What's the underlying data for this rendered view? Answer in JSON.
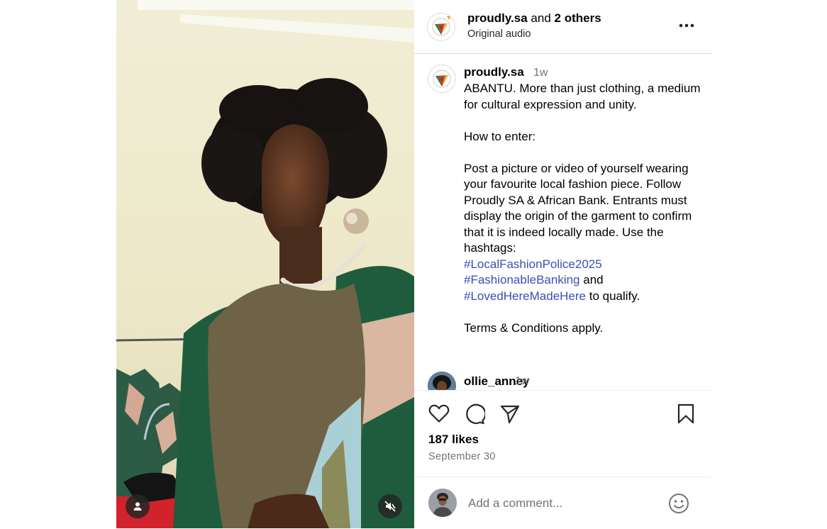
{
  "post": {
    "author": "proudly.sa",
    "coauthor_text": " and ",
    "others": "2 others",
    "audio": "Original audio"
  },
  "caption": {
    "username": "proudly.sa",
    "time": "1w",
    "text_before": "ABANTU. More than just clothing, a medium for cultural expression and unity.\n\nHow to enter:\n\nPost a picture or video of yourself wearing your favourite local fashion piece. Follow Proudly SA & African Bank. Entrants must display the origin of the garment to confirm that it is indeed locally made. Use the hashtags:\n",
    "hashtag1": "#LocalFashionPolice2025",
    "hashtag2": "#FashionableBanking",
    "and_text": " and",
    "hashtag3": "#LovedHereMadeHere",
    "text_after": " to qualify.\n\nTerms & Conditions apply."
  },
  "comment": {
    "username": "ollie_anney",
    "time": "1w"
  },
  "actions": {
    "like_icon": "heart-icon",
    "comment_icon": "comment-bubble-icon",
    "share_icon": "paper-plane-icon",
    "save_icon": "bookmark-icon"
  },
  "likes": "187 likes",
  "date": "September 30",
  "comment_box": {
    "placeholder": "Add a comment...",
    "emoji_icon": "emoji-smile-icon"
  },
  "media": {
    "tags_icon": "user-tag-icon",
    "mute_icon": "speaker-muted-icon"
  },
  "colors": {
    "hashtag": "#3850b5",
    "muted_text": "#737373",
    "divider": "#dbdbdb"
  }
}
